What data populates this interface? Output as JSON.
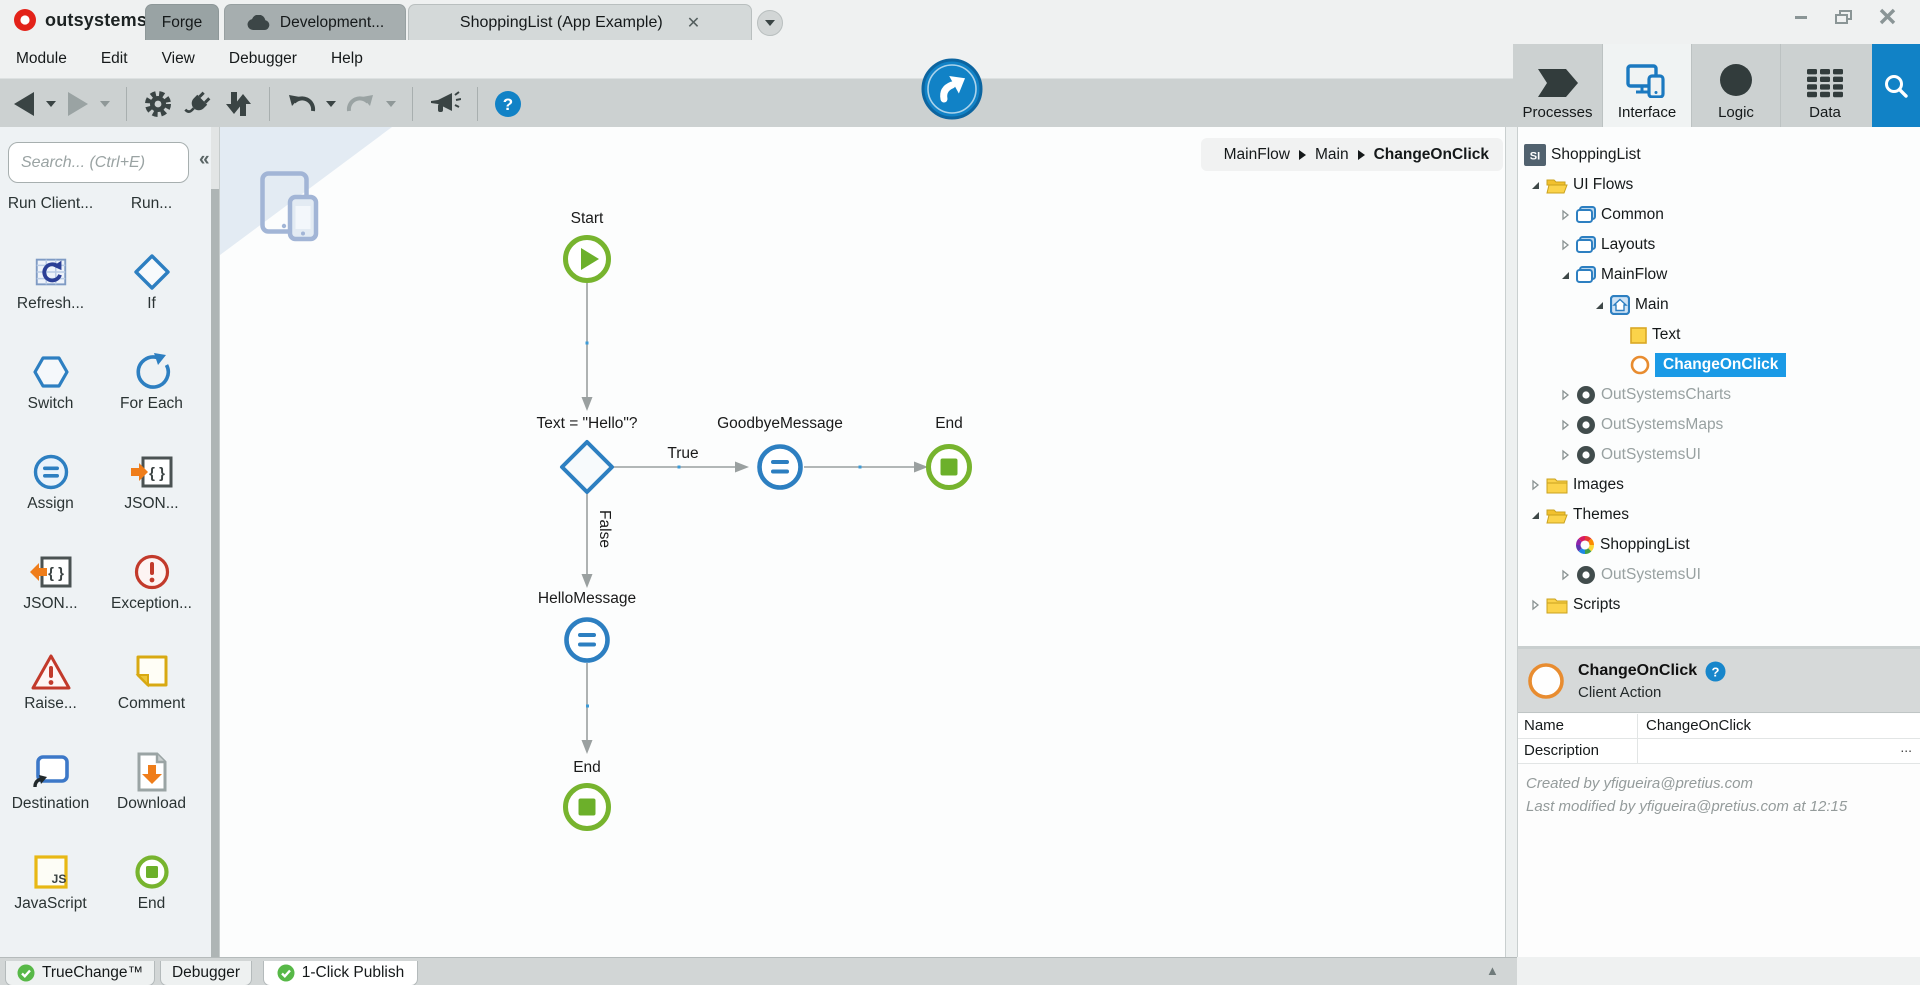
{
  "titlebar": {
    "logo_text": "outsystems",
    "tabs": [
      {
        "label": "Forge"
      },
      {
        "label": "Development...",
        "icon": "cloud-icon"
      },
      {
        "label": "ShoppingList (App Example)",
        "active": true
      }
    ]
  },
  "menubar": {
    "items": [
      "Module",
      "Edit",
      "View",
      "Debugger",
      "Help"
    ]
  },
  "nav": {
    "items": [
      {
        "label": "Processes",
        "icon": "process-flag-icon",
        "active": false
      },
      {
        "label": "Interface",
        "icon": "devices-icon",
        "active": true
      },
      {
        "label": "Logic",
        "icon": "logic-circle-icon",
        "active": false
      },
      {
        "label": "Data",
        "icon": "data-grid-icon",
        "active": false
      }
    ]
  },
  "toolbox": {
    "search_placeholder": "Search... (Ctrl+E)",
    "collapse_glyph": "«",
    "items": [
      {
        "label": "Run Client...",
        "icon": "none"
      },
      {
        "label": "Run...",
        "icon": "none"
      },
      {
        "label": "Refresh...",
        "icon": "refresh-data-icon"
      },
      {
        "label": "If",
        "icon": "if-diamond-icon"
      },
      {
        "label": "Switch",
        "icon": "switch-hexagon-icon"
      },
      {
        "label": "For Each",
        "icon": "for-each-icon"
      },
      {
        "label": "Assign",
        "icon": "assign-icon"
      },
      {
        "label": "JSON...",
        "icon": "json-serialize-icon"
      },
      {
        "label": "JSON...",
        "icon": "json-deserialize-icon"
      },
      {
        "label": "Exception...",
        "icon": "exception-icon"
      },
      {
        "label": "Raise...",
        "icon": "raise-exception-icon"
      },
      {
        "label": "Comment",
        "icon": "comment-icon"
      },
      {
        "label": "Destination",
        "icon": "destination-icon"
      },
      {
        "label": "Download",
        "icon": "download-icon"
      },
      {
        "label": "JavaScript",
        "icon": "javascript-icon"
      },
      {
        "label": "End",
        "icon": "end-node-icon"
      }
    ]
  },
  "canvas": {
    "breadcrumb": [
      "MainFlow",
      "Main",
      "ChangeOnClick"
    ],
    "flow": {
      "start": "Start",
      "condition": "Text = \"Hello\"?",
      "true_branch": "True",
      "false_branch": "False",
      "goodbye": "GoodbyeMessage",
      "end_top": "End",
      "hello": "HelloMessage",
      "end_bottom": "End"
    }
  },
  "tree": {
    "items": [
      {
        "label": "ShoppingList",
        "icon": "module-icon",
        "level": 0
      },
      {
        "label": "UI Flows",
        "icon": "folder-open-icon",
        "level": 1,
        "state": "expanded"
      },
      {
        "label": "Common",
        "icon": "ui-flow-icon",
        "level": 2,
        "state": "collapsed"
      },
      {
        "label": "Layouts",
        "icon": "ui-flow-icon",
        "level": 2,
        "state": "collapsed"
      },
      {
        "label": "MainFlow",
        "icon": "ui-flow-icon",
        "level": 2,
        "state": "expanded"
      },
      {
        "label": "Main",
        "icon": "home-screen-icon",
        "level": 3,
        "state": "expanded"
      },
      {
        "label": "Text",
        "icon": "widget-icon",
        "level": 4
      },
      {
        "label": "ChangeOnClick",
        "icon": "client-action-icon",
        "level": 4,
        "selected": true
      },
      {
        "label": "OutSystemsCharts",
        "icon": "plugin-icon",
        "level": 2,
        "state": "collapsed",
        "dimmed": true
      },
      {
        "label": "OutSystemsMaps",
        "icon": "plugin-icon",
        "level": 2,
        "state": "collapsed",
        "dimmed": true
      },
      {
        "label": "OutSystemsUI",
        "icon": "plugin-icon",
        "level": 2,
        "state": "collapsed",
        "dimmed": true
      },
      {
        "label": "Images",
        "icon": "folder-icon",
        "level": 1,
        "state": "collapsed"
      },
      {
        "label": "Themes",
        "icon": "folder-open-icon",
        "level": 1,
        "state": "expanded"
      },
      {
        "label": "ShoppingList",
        "icon": "theme-icon",
        "level": 2
      },
      {
        "label": "OutSystemsUI",
        "icon": "plugin-icon",
        "level": 2,
        "state": "collapsed",
        "dimmed": true
      },
      {
        "label": "Scripts",
        "icon": "folder-icon",
        "level": 1,
        "state": "collapsed"
      }
    ]
  },
  "properties": {
    "title": "ChangeOnClick",
    "subtitle": "Client Action",
    "rows": [
      {
        "label": "Name",
        "value": "ChangeOnClick"
      },
      {
        "label": "Description",
        "value": "",
        "more": "..."
      }
    ],
    "created": "Created by yfigueira@pretius.com",
    "modified": "Last modified by yfigueira@pretius.com at 12:15"
  },
  "statusbar": {
    "items": [
      {
        "label": "TrueChange™",
        "icon": "check-icon"
      },
      {
        "label": "Debugger"
      },
      {
        "label": "1-Click Publish",
        "icon": "check-icon"
      }
    ],
    "collapse_glyph": "▲"
  },
  "colors": {
    "accent_blue": "#1182c6",
    "selection_blue": "#1a9ae6",
    "node_green": "#6cb02a",
    "node_blue": "#2d7fc1",
    "logo_red": "#e32219",
    "check_green": "#57b847"
  }
}
